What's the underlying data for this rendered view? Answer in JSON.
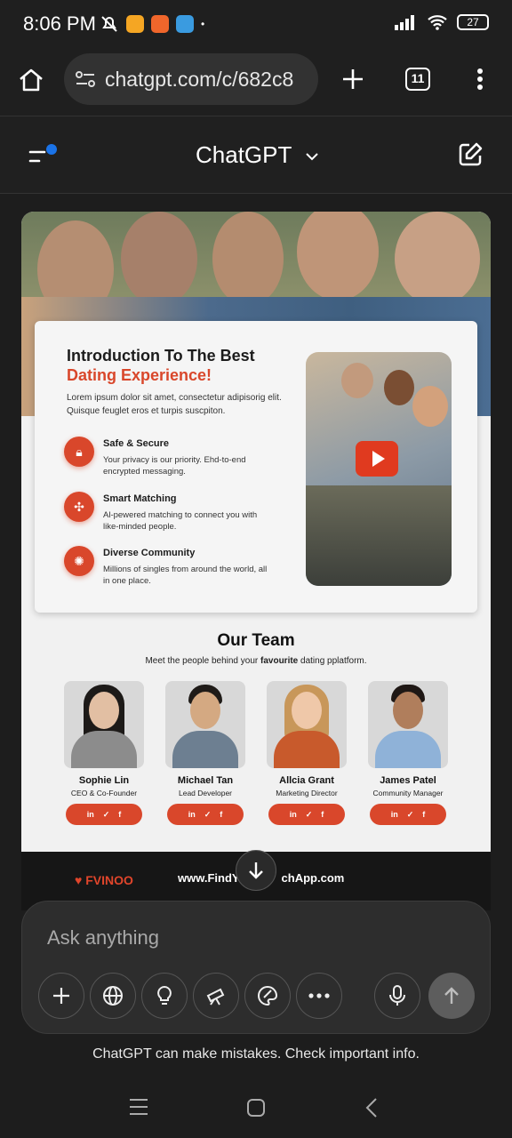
{
  "status": {
    "time": "8:06 PM",
    "battery": "27"
  },
  "browser": {
    "url": "chatgpt.com/c/682c8",
    "tab_count": "11"
  },
  "app": {
    "title": "ChatGPT"
  },
  "image": {
    "intro_title_line1": "Introduction To The Best",
    "intro_title_line2": "Dating Experience!",
    "intro_text": "Lorem ipsum dolor sit amet, consectetur adipisorig elit. Quisque feuglet eros et turpis suscpiton.",
    "features": [
      {
        "title": "Safe & Secure",
        "desc": "Your privacy is our priority. Ehd-to-end encrypted messaging."
      },
      {
        "title": "Smart Matching",
        "desc": "Al-pewered matching to connect you with like-minded people."
      },
      {
        "title": "Diverse Community",
        "desc": "Millions of singles from around the world, all in one place."
      }
    ],
    "team_title": "Our Team",
    "team_sub_pre": "Meet the people behind your ",
    "team_sub_bold": "favourite",
    "team_sub_post": " dating pplatform.",
    "members": [
      {
        "name": "Sophie Lin",
        "role": "CEO & Co-Founder"
      },
      {
        "name": "Michael Tan",
        "role": "Lead Developer"
      },
      {
        "name": "Allcia Grant",
        "role": "Marketing Director"
      },
      {
        "name": "James Patel",
        "role": "Community Manager"
      }
    ],
    "socials": {
      "in": "in",
      "tw": "✓",
      "fb": "f"
    },
    "brand": "FVINOO",
    "brand_url": "www.FindYo",
    "brand_url_tail": "chApp.com"
  },
  "composer": {
    "placeholder": "Ask anything"
  },
  "disclaimer": "ChatGPT can make mistakes. Check important info.",
  "colors": {
    "accent": "#d9472b",
    "bg": "#1d1d1d"
  }
}
